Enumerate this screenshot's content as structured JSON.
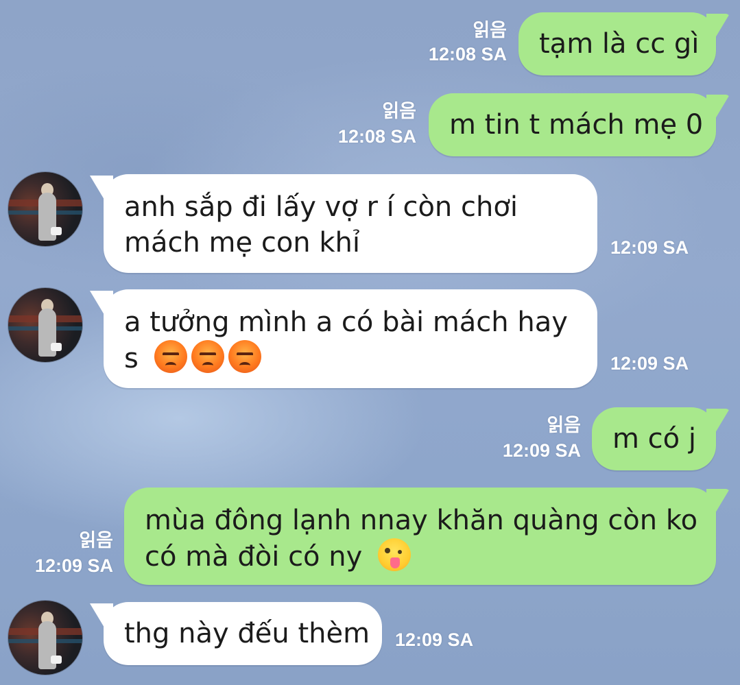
{
  "messages": [
    {
      "id": "m1",
      "direction": "outgoing",
      "read_label": "읽음",
      "time": "12:08 SA",
      "lines": [
        "tạm là cc gì"
      ]
    },
    {
      "id": "m2",
      "direction": "outgoing",
      "read_label": "읽음",
      "time": "12:08 SA",
      "lines": [
        "m tin t mách mẹ 0"
      ]
    },
    {
      "id": "m3",
      "direction": "incoming",
      "time": "12:09 SA",
      "lines": [
        "anh sắp đi lấy vợ r í còn chơi",
        "mách mẹ con khỉ"
      ]
    },
    {
      "id": "m4",
      "direction": "incoming",
      "time": "12:09 SA",
      "lines": [
        "a tưởng mình a có bài mách hay",
        "s"
      ],
      "emojis": [
        "angry-face-icon",
        "angry-face-icon",
        "angry-face-icon"
      ]
    },
    {
      "id": "m5",
      "direction": "outgoing",
      "read_label": "읽음",
      "time": "12:09 SA",
      "lines": [
        "m có j"
      ]
    },
    {
      "id": "m6",
      "direction": "outgoing",
      "read_label": "읽음",
      "time": "12:09 SA",
      "lines": [
        "mùa đông lạnh nnay khăn quàng còn ko",
        "có mà đòi có ny"
      ],
      "emojis": [
        "winking-tongue-face-icon"
      ]
    },
    {
      "id": "m7",
      "direction": "incoming",
      "time": "12:09 SA",
      "lines": [
        "thg này đếu thèm"
      ]
    }
  ],
  "colors": {
    "outgoing_bubble": "#a8e88c",
    "incoming_bubble": "#ffffff",
    "background": "#8ea6cb",
    "meta_text": "#ffffff"
  }
}
